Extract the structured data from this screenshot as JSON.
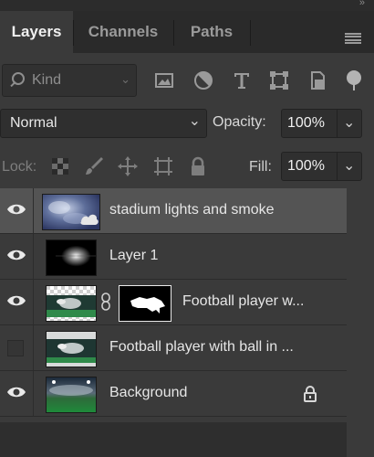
{
  "tabs": [
    {
      "label": "Layers",
      "active": true
    },
    {
      "label": "Channels",
      "active": false
    },
    {
      "label": "Paths",
      "active": false
    }
  ],
  "filter": {
    "placeholder": "Kind",
    "icons": [
      "image-filter-icon",
      "adjustment-filter-icon",
      "type-filter-icon",
      "shape-filter-icon",
      "smart-object-filter-icon",
      "filter-toggle-icon"
    ]
  },
  "blend": {
    "mode": "Normal",
    "opacity_label": "Opacity:",
    "opacity_value": "100%"
  },
  "lock": {
    "label": "Lock:",
    "icons": [
      "lock-transparent-pixels-icon",
      "lock-image-pixels-icon",
      "lock-position-icon",
      "lock-artboard-icon",
      "lock-all-icon"
    ],
    "fill_label": "Fill:",
    "fill_value": "100%"
  },
  "layers": [
    {
      "name": "stadium lights and smoke",
      "visible": true,
      "selected": true,
      "thumb": "smoke-smart-object"
    },
    {
      "name": "Layer 1",
      "visible": true,
      "selected": false,
      "thumb": "light-flare"
    },
    {
      "name": "Football player w...",
      "visible": true,
      "selected": false,
      "thumb": "player-with-mask",
      "has_mask": true
    },
    {
      "name": "Football player with ball in ...",
      "visible": false,
      "selected": false,
      "thumb": "player-copy"
    },
    {
      "name": "Background",
      "visible": true,
      "selected": false,
      "thumb": "stadium",
      "locked": true
    }
  ],
  "colors": {
    "panel": "#3a3a3a",
    "tabbar": "#2a2a2a",
    "selected_row": "#545454"
  }
}
